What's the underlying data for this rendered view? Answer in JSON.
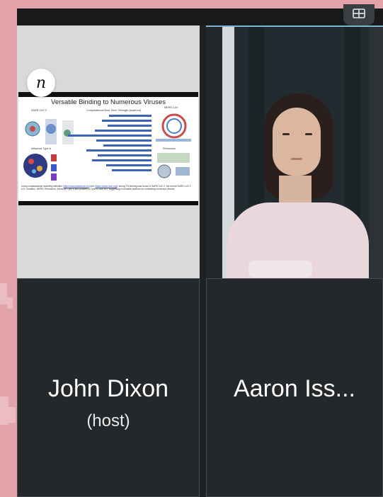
{
  "layout_button": {
    "icon": "grid-view-icon"
  },
  "shared_screen": {
    "logo_glyph": "n",
    "slide": {
      "title": "Versatile Binding to Numerous Viruses",
      "label_left": "SARS CoV 2",
      "label_chart": "Computational Bind Time* Strength (kcal/mol)",
      "label_mers": "MERS CoV",
      "label_flu": "Influenza Type A",
      "label_rhino": "Rhinovirus",
      "caption_start": "Using computational modeling websites (",
      "caption_link1": "http://www.swissdock.ch",
      "caption_mid": ") and (",
      "caption_link2": "https://www.rcsb.org",
      "caption_end": "), strong TB binding was found to SARS CoV 2, the recent SARS CoV 2 U.K. mutation, MERS, Rhinovirus, Influenza Type A and portions of Type B, and HIV, suggesting a versatile platform for combating numerous viruses."
    }
  },
  "participants": [
    {
      "name": "John Dixon",
      "role": "(host)"
    },
    {
      "name": "Aaron Iss...",
      "role": ""
    }
  ]
}
